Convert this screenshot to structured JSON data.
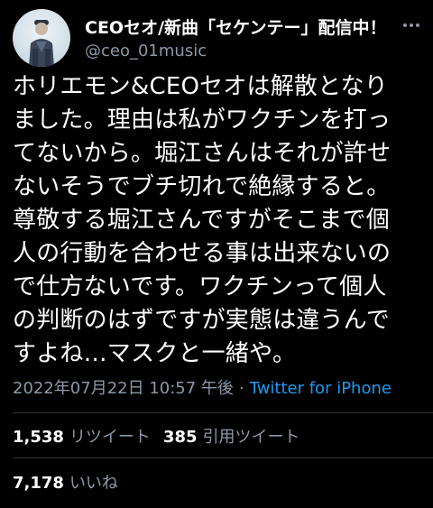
{
  "author": {
    "display_name": "CEOセオ/新曲「セケンテー」配信中！",
    "handle": "@ceo_01music"
  },
  "tweet": {
    "lines": [
      "ホリエモン&CEOセオは解散となり",
      "ました。理由は私がワクチンを打っ",
      "てないから。堀江さんはそれが許せ",
      "ないそうでブチ切れで絶縁すると。",
      "尊敬する堀江さんですがそこまで個",
      "人の行動を合わせる事は出来ないの",
      "で仕方ないです。ワクチンって個人",
      "の判断のはずですが実態は違うんで",
      "すよね…マスクと一緒や。"
    ],
    "timestamp": "2022年07月22日 10:57 午後",
    "separator": "·",
    "source": "Twitter for iPhone"
  },
  "stats": {
    "retweets_count": "1,538",
    "retweets_label": "リツイート",
    "quotes_count": "385",
    "quotes_label": "引用ツイート",
    "likes_count": "7,178",
    "likes_label": "いいね"
  },
  "colors": {
    "background": "#000000",
    "text": "#ffffff",
    "muted": "#8b98a5",
    "link": "#1d9bf0",
    "divider": "#2f3336"
  },
  "icons": {
    "more": "more-dots-icon",
    "avatar": "avatar"
  }
}
